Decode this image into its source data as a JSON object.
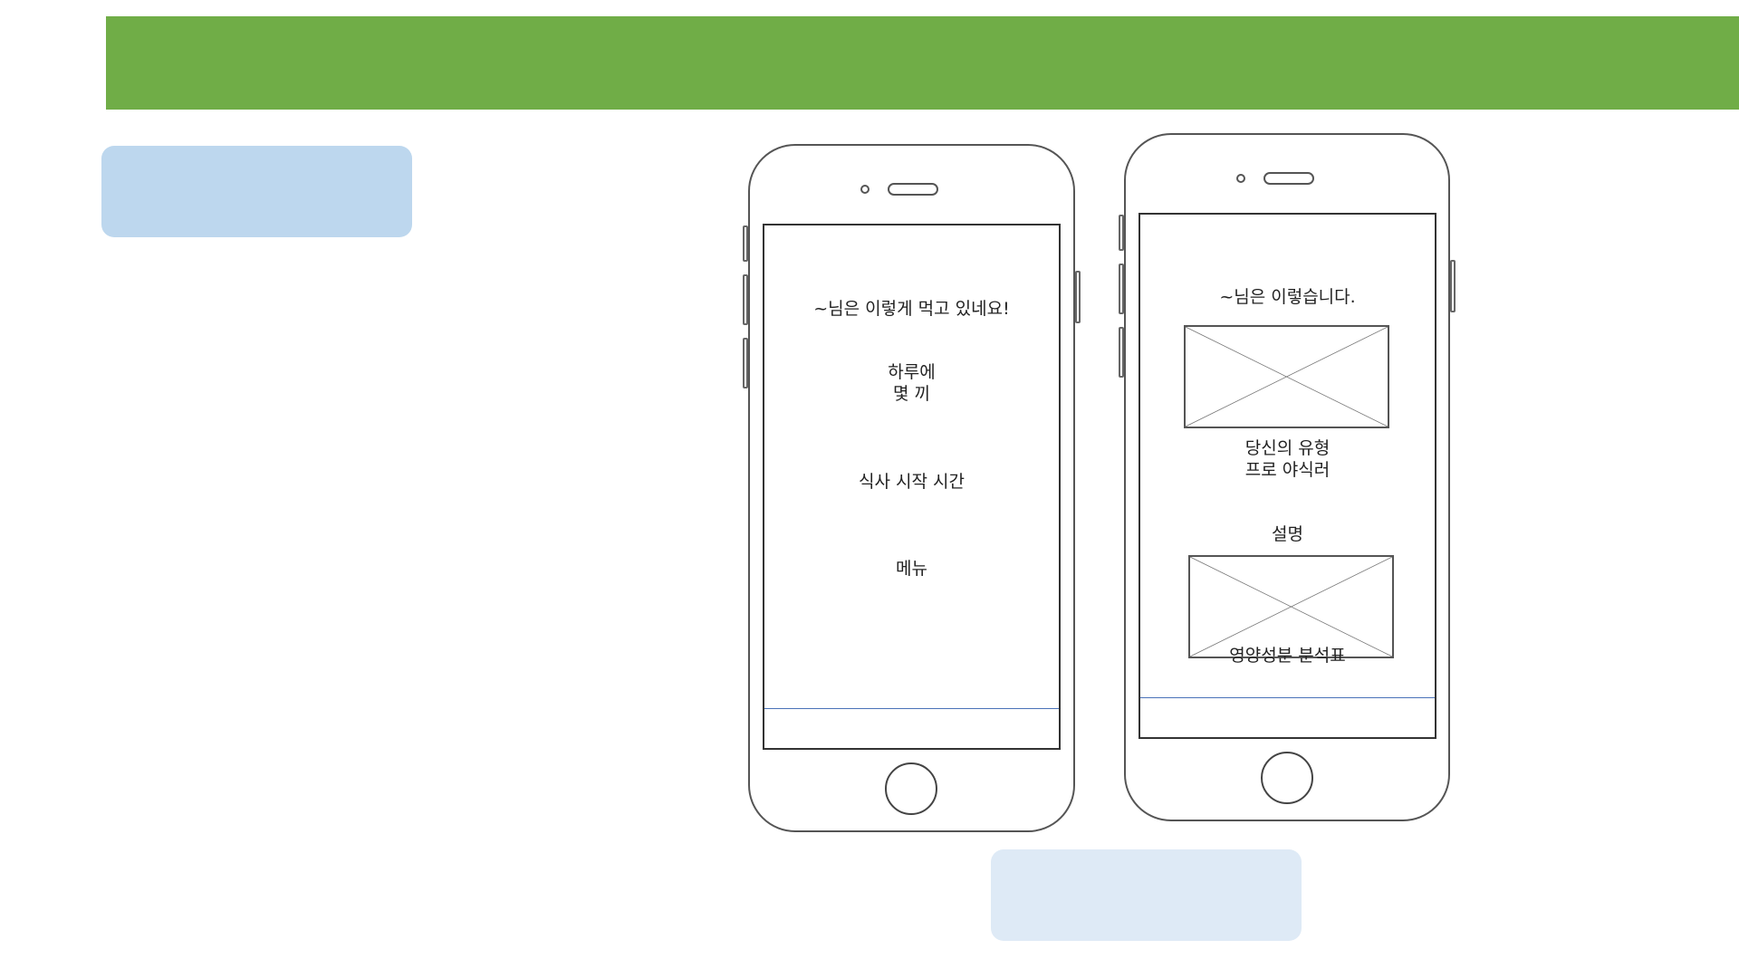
{
  "colors": {
    "header_bar": "#70ad47",
    "label_box_top": "#bdd7ee",
    "label_box_bottom": "#deeaf6",
    "tab_line": "#4a72b8"
  },
  "screen1": {
    "title": "~님은 이렇게 먹고 있네요!",
    "meals_line1": "하루에",
    "meals_line2": "몇 끼",
    "start_time": "식사 시작 시간",
    "menu": "메뉴"
  },
  "screen2": {
    "title": "~님은 이렇습니다.",
    "type_line1": "당신의 유형",
    "type_line2": "프로 야식러",
    "description": "설명",
    "nutrition_table": "영양성분 분석표"
  }
}
